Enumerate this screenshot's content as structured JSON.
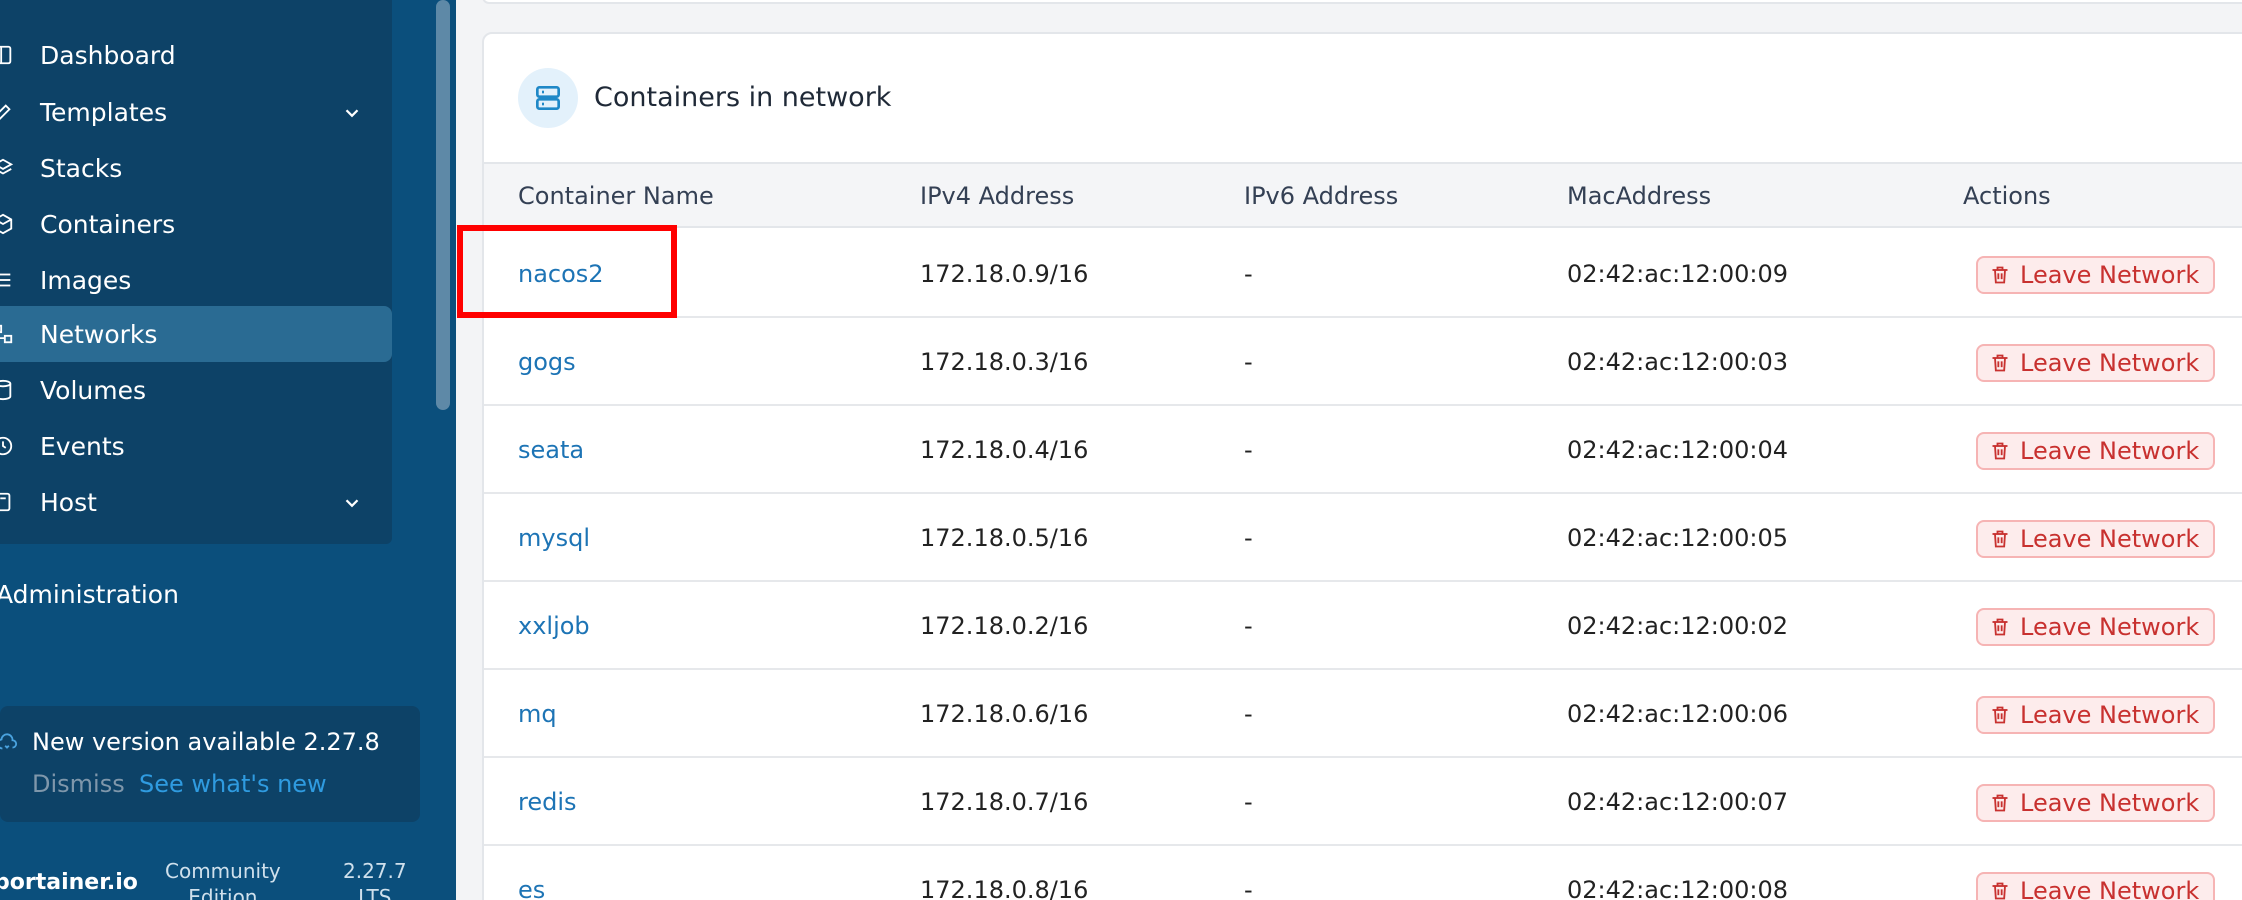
{
  "sidebar": {
    "nav_items": [
      {
        "label": "Dashboard",
        "icon": "dashboard-icon"
      },
      {
        "label": "Templates",
        "icon": "edit-icon"
      },
      {
        "label": "Stacks",
        "icon": "layers-icon"
      },
      {
        "label": "Containers",
        "icon": "box-icon"
      },
      {
        "label": "Images",
        "icon": "list-icon"
      },
      {
        "label": "Networks",
        "icon": "network-icon",
        "active": true
      },
      {
        "label": "Volumes",
        "icon": "database-icon"
      },
      {
        "label": "Events",
        "icon": "history-icon"
      },
      {
        "label": "Host",
        "icon": "server-icon"
      }
    ],
    "admin_heading": "Administration",
    "update": {
      "title": "New version available 2.27.8",
      "dismiss_label": "Dismiss",
      "whats_new_label": "See what's new"
    },
    "footer": {
      "brand": "portainer.io",
      "edition_line1": "Community",
      "edition_line2": "Edition",
      "version_line1": "2.27.7",
      "version_line2": "LTS"
    }
  },
  "card": {
    "title": "Containers in network",
    "columns": [
      "Container Name",
      "IPv4 Address",
      "IPv6 Address",
      "MacAddress",
      "Actions"
    ],
    "action_label": "Leave Network",
    "rows": [
      {
        "name": "nacos2",
        "ipv4": "172.18.0.9/16",
        "ipv6": "-",
        "mac": "02:42:ac:12:00:09"
      },
      {
        "name": "gogs",
        "ipv4": "172.18.0.3/16",
        "ipv6": "-",
        "mac": "02:42:ac:12:00:03"
      },
      {
        "name": "seata",
        "ipv4": "172.18.0.4/16",
        "ipv6": "-",
        "mac": "02:42:ac:12:00:04"
      },
      {
        "name": "mysql",
        "ipv4": "172.18.0.5/16",
        "ipv6": "-",
        "mac": "02:42:ac:12:00:05"
      },
      {
        "name": "xxljob",
        "ipv4": "172.18.0.2/16",
        "ipv6": "-",
        "mac": "02:42:ac:12:00:02"
      },
      {
        "name": "mq",
        "ipv4": "172.18.0.6/16",
        "ipv6": "-",
        "mac": "02:42:ac:12:00:06"
      },
      {
        "name": "redis",
        "ipv4": "172.18.0.7/16",
        "ipv6": "-",
        "mac": "02:42:ac:12:00:07"
      },
      {
        "name": "es",
        "ipv4": "172.18.0.8/16",
        "ipv6": "-",
        "mac": "02:42:ac:12:00:08"
      }
    ]
  },
  "colors": {
    "sidebar_bg": "#0b4f7c",
    "sidebar_group_bg": "#0d4267",
    "active_item_bg": "#2a6b93",
    "link": "#1d74b5",
    "danger": "#c8312f",
    "highlight": "#ff0000"
  }
}
